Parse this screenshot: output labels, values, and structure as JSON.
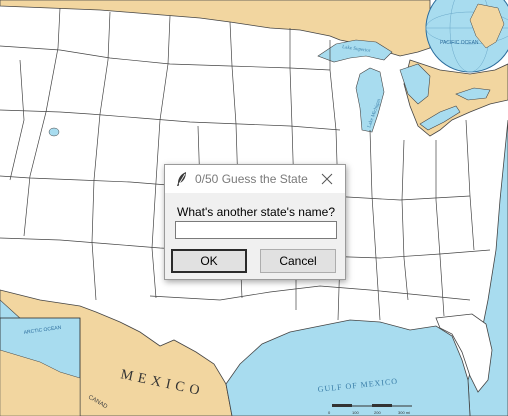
{
  "map": {
    "labels": {
      "mexico": "MEXICO",
      "gulf_of_mexico": "GULF OF MEXICO",
      "lake_superior": "Lake Superior",
      "lake_michigan": "Lake Michigan",
      "pacific_ocean": "PACIFIC OCEAN",
      "arctic_ocean": "ARCTIC OCEAN",
      "canada_partial": "CANAD",
      "scale_0": "0",
      "scale_100": "100",
      "scale_200": "200",
      "scale_300": "300 mi"
    },
    "colors": {
      "water": "#a8dcef",
      "foreign_land": "#f2d6a0",
      "us_land": "#ffffff",
      "borders": "#444444",
      "label_blue": "#3a7ea8"
    }
  },
  "dialog": {
    "title": "0/50 Guess the State",
    "prompt": "What's another state's name?",
    "input_value": "",
    "ok_label": "OK",
    "cancel_label": "Cancel",
    "icon": "feather-icon"
  }
}
